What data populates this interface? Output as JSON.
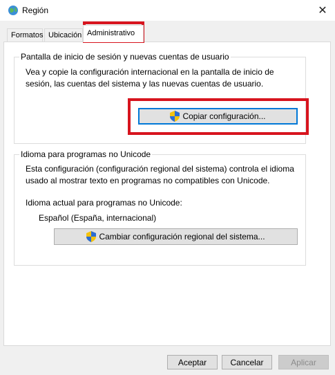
{
  "window": {
    "title": "Región",
    "icon": "globe-icon",
    "close_glyph": "✕"
  },
  "tabs": [
    {
      "label": "Formatos",
      "active": false
    },
    {
      "label": "Ubicación",
      "active": false
    },
    {
      "label": "Administrativo",
      "active": true
    }
  ],
  "welcome_group": {
    "title": "Pantalla de inicio de sesión y nuevas cuentas de usuario",
    "description": "Vea y copie la configuración internacional en la pantalla de inicio de sesión, las cuentas del sistema y las nuevas cuentas de usuario.",
    "copy_button": "Copiar configuración..."
  },
  "unicode_group": {
    "title": "Idioma para programas no Unicode",
    "description": "Esta configuración (configuración regional del sistema) controla el idioma usado al mostrar texto en programas no compatibles con Unicode.",
    "current_label": "Idioma actual para programas no Unicode:",
    "current_value": "Español (España, internacional)",
    "change_button": "Cambiar configuración regional del sistema..."
  },
  "footer": {
    "ok": "Aceptar",
    "cancel": "Cancelar",
    "apply": "Aplicar"
  },
  "colors": {
    "highlight": "#d7141e",
    "focus": "#0078d7"
  }
}
